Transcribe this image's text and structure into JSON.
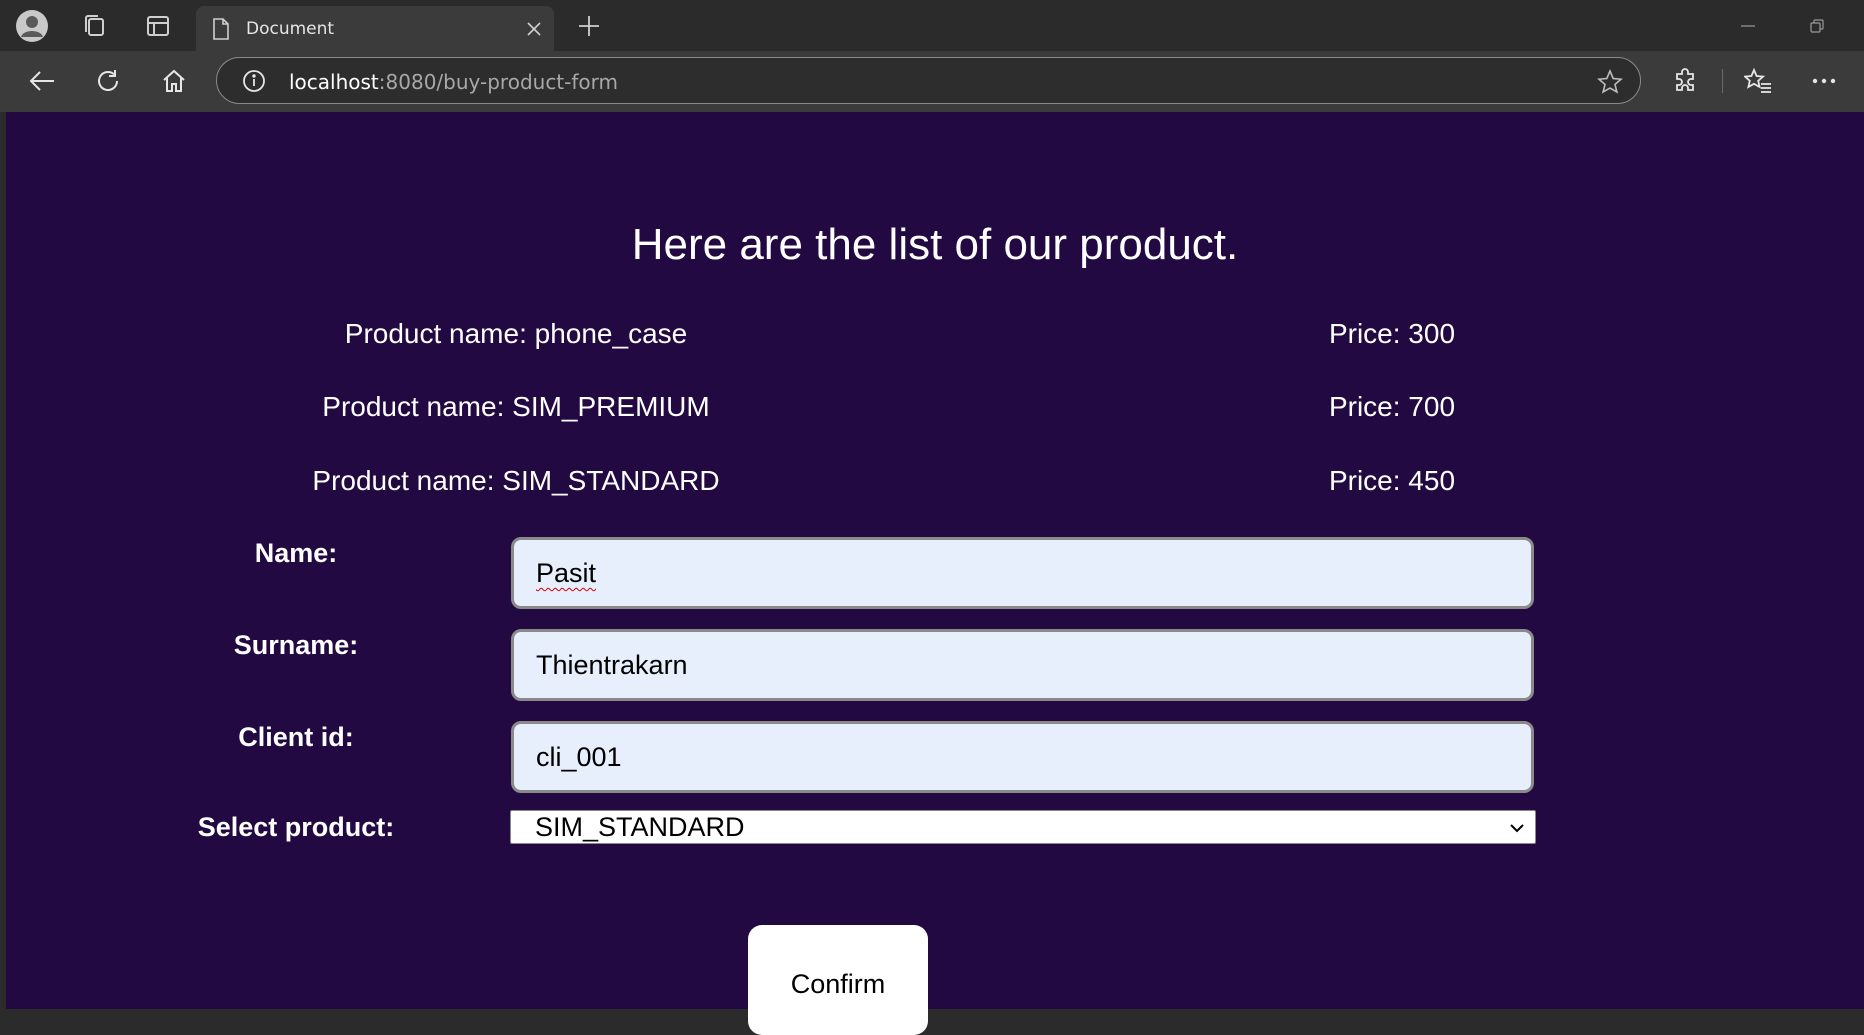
{
  "browser": {
    "tab_title": "Document",
    "url_host": "localhost",
    "url_path": ":8080/buy-product-form"
  },
  "page": {
    "heading": "Here are the list of our product.",
    "products": [
      {
        "name": "Product name: phone_case",
        "price": "Price: 300"
      },
      {
        "name": "Product name: SIM_PREMIUM",
        "price": "Price: 700"
      },
      {
        "name": "Product name: SIM_STANDARD",
        "price": "Price: 450"
      }
    ],
    "form": {
      "name_label": "Name:",
      "name_value": "Pasit",
      "surname_label": "Surname:",
      "surname_value": "Thientrakarn",
      "client_label": "Client id:",
      "client_value": "cli_001",
      "product_label": "Select product:",
      "product_value": "SIM_STANDARD",
      "confirm_label": "Confirm"
    }
  },
  "colors": {
    "page_background": "#220941",
    "input_background": "#e8effc",
    "browser_chrome": "#2b2b2b"
  }
}
